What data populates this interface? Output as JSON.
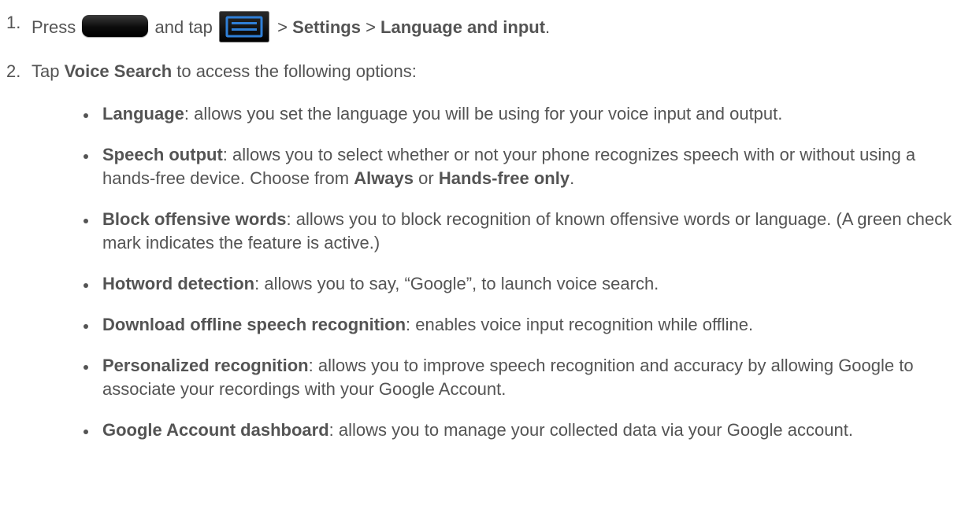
{
  "steps": [
    {
      "number": "1.",
      "text_press": "Press",
      "home_key_icon": "home-key-icon",
      "text_and_tap": "and tap",
      "menu_key_icon": "menu-key-icon",
      "sep1": ">",
      "settings": "Settings",
      "sep2": ">",
      "language_and_input": "Language and input",
      "end": "."
    },
    {
      "number": "2.",
      "text_tap": "Tap",
      "voice_search": "Voice Search",
      "rest": "to access the following options:"
    }
  ],
  "options": [
    {
      "title": "Language",
      "desc": ": allows you set the language you will be using for your voice input and output."
    },
    {
      "title": "Speech output",
      "desc_pre": ": allows you to select whether or not your phone recognizes speech with or without using a hands-free device. Choose from",
      "choice1": "Always",
      "or": "or",
      "choice2": "Hands-free only",
      "end": "."
    },
    {
      "title": "Block offensive words",
      "desc": ": allows you to block recognition of known offensive words or language. (A green check mark indicates the feature is active.)"
    },
    {
      "title": "Hotword detection",
      "desc": ": allows you to say, “Google”, to launch voice search."
    },
    {
      "title": "Download offline speech recognition",
      "desc": ": enables voice input recognition while offline."
    },
    {
      "title": "Personalized recognition",
      "desc": ": allows you to improve speech recognition and accuracy by allowing Google to associate your recordings with your Google Account."
    },
    {
      "title": "Google Account dashboard",
      "desc": ": allows you to manage your collected data via your Google account."
    }
  ],
  "colors": {
    "text": "#545454",
    "background": "#ffffff"
  }
}
